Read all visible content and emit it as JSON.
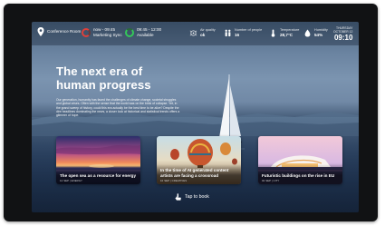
{
  "topbar": {
    "room_name": "Conference Room",
    "meeting1": {
      "time": "now - 09:45",
      "title": "Marketing Sync"
    },
    "meeting2": {
      "time": "09:45 - 12:00",
      "status": "Available"
    },
    "air_quality": {
      "label": "Air quality",
      "value": "ok"
    },
    "people": {
      "label": "Number of people",
      "value": "16"
    },
    "temperature": {
      "label": "Temperature",
      "value": "28,7°C"
    },
    "humidity": {
      "label": "Humidity",
      "value": "54%"
    },
    "clock": {
      "day": "THURSDAY",
      "date": "OCTOBER 12",
      "time": "09:10"
    }
  },
  "hero": {
    "title_line1": "The next era of",
    "title_line2": "human progress",
    "body": "Our generation, humanity has faced the challenges of climate change, societal struggles and global crises. Often with the sense that the world was on the brink of collapse. Yet, in the grand sweep of history, could this era actually be the best time to be alive? Despite the dire headlines dominating the news, a closer look at historical and statistical trends offers a glimmer of hope."
  },
  "cards": [
    {
      "title": "The open sea as a resource for energy",
      "meta": "12 SEP | ENERGY"
    },
    {
      "title": "In the time of AI generated content artists are facing a crossroad",
      "meta": "10 SEP | CREATIVES"
    },
    {
      "title": "Futuristic buildings on the rise in EU",
      "meta": "02 SEP | CITY"
    }
  ],
  "cta": {
    "label": "Tap to book"
  },
  "colors": {
    "busy_ring": "#e0403a",
    "available_ring": "#34c759",
    "frame": "#111214"
  },
  "icons": [
    "location-pin-icon",
    "air-quality-icon",
    "people-icon",
    "thermometer-icon",
    "humidity-drop-icon",
    "hand-tap-icon"
  ]
}
